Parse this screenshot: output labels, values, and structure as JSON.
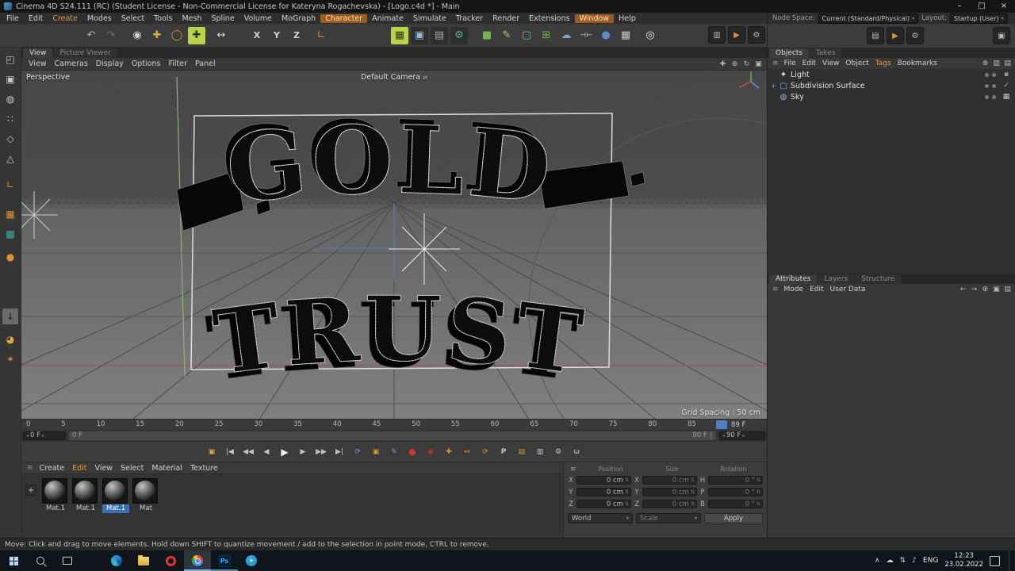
{
  "titlebar": {
    "title": "Cinema 4D S24.111 (RC) (Student License - Non-Commercial License for Kateryna Rogachevska) - [Logo.c4d *] - Main",
    "minimize": "–",
    "maximize": "□",
    "close": "×"
  },
  "menubar": {
    "items": [
      {
        "label": "File",
        "cls": "mb"
      },
      {
        "label": "Edit",
        "cls": "mb"
      },
      {
        "label": "Create",
        "cls": "mb accent-text"
      },
      {
        "label": "Modes",
        "cls": "mb"
      },
      {
        "label": "Select",
        "cls": "mb"
      },
      {
        "label": "Tools",
        "cls": "mb"
      },
      {
        "label": "Mesh",
        "cls": "mb"
      },
      {
        "label": "Spline",
        "cls": "mb"
      },
      {
        "label": "Volume",
        "cls": "mb"
      },
      {
        "label": "MoGraph",
        "cls": "mb"
      },
      {
        "label": "Character",
        "cls": "mb accent-bg"
      },
      {
        "label": "Animate",
        "cls": "mb"
      },
      {
        "label": "Simulate",
        "cls": "mb"
      },
      {
        "label": "Tracker",
        "cls": "mb"
      },
      {
        "label": "Render",
        "cls": "mb"
      },
      {
        "label": "Extensions",
        "cls": "mb"
      },
      {
        "label": "Window",
        "cls": "mb accent-bg"
      },
      {
        "label": "Help",
        "cls": "mb"
      }
    ]
  },
  "nodespace": {
    "label": "Node Space:",
    "value": "Current (Standard/Physical)",
    "layout_label": "Layout:",
    "layout_value": "Startup (User)",
    "arrow": "▾"
  },
  "toolbar": {
    "icons": [
      {
        "name": "undo-icon",
        "glyph": "↶",
        "style": "color:#b0b0b0"
      },
      {
        "name": "redo-icon",
        "glyph": "↷",
        "style": "color:#6e6e6e"
      },
      {
        "name": "live-selection-icon",
        "glyph": "◉",
        "style": "color:#cfcfcf"
      },
      {
        "name": "move-tool-icon",
        "glyph": "✚",
        "style": "color:#d9a648"
      },
      {
        "name": "rotate-tool-icon",
        "glyph": "◯",
        "style": "color:#e0912f"
      },
      {
        "name": "active-move-tool-icon",
        "glyph": "✚",
        "style": "background:#b8d24a;color:#2a3a10;border-radius:2px"
      },
      {
        "name": "scale-tool-icon",
        "glyph": "↔",
        "style": "color:#d8d8d8"
      },
      {
        "name": "axis-x-lock-button",
        "glyph": "X",
        "style": "color:#d0d0d0"
      },
      {
        "name": "axis-y-lock-button",
        "glyph": "Y",
        "style": "color:#d0d0d0"
      },
      {
        "name": "axis-z-lock-button",
        "glyph": "Z",
        "style": "color:#d0d0d0"
      },
      {
        "name": "coordinate-system-icon",
        "glyph": "∟",
        "style": "color:#e0912f"
      },
      {
        "name": "asset-browser-icon",
        "glyph": "▦",
        "style": "background:#b8d24a;color:#2a3a10;border-radius:2px"
      },
      {
        "name": "render-view-icon",
        "glyph": "▣",
        "style": "color:#8fb9d8;background:#2e2e2e;border-radius:2px"
      },
      {
        "name": "render-picture-viewer-icon",
        "glyph": "▤",
        "style": "color:#9aaab0;background:#2e2e2e;border-radius:2px"
      },
      {
        "name": "render-settings-icon",
        "glyph": "⚙",
        "style": "color:#49b3a2;background:#2e2e2e;border-radius:2px"
      },
      {
        "name": "add-cube-icon",
        "glyph": "■",
        "style": "color:#79b24a"
      },
      {
        "name": "pen-spline-icon",
        "glyph": "✎",
        "style": "color:#a8d06a"
      },
      {
        "name": "subdivision-surface-icon",
        "glyph": "▢",
        "style": "color:#6fc08a"
      },
      {
        "name": "cloner-icon",
        "glyph": "⊞",
        "style": "color:#6fb24a"
      },
      {
        "name": "volume-icon",
        "glyph": "☁",
        "style": "color:#7fa8c8"
      },
      {
        "name": "symmetry-icon",
        "glyph": "⊣⊢",
        "style": "color:#d8d8d8;font-size:9px"
      },
      {
        "name": "deformer-icon",
        "glyph": "●",
        "style": "color:#5b8fd0"
      },
      {
        "name": "array-icon",
        "glyph": "▦",
        "style": "color:#c8c8c8"
      },
      {
        "name": "light-object-icon",
        "glyph": "◎",
        "style": "color:#e8e8e8"
      }
    ],
    "right_icons": [
      {
        "name": "interactive-render-icon",
        "glyph": "▥",
        "style": ""
      },
      {
        "name": "render-queue-icon",
        "glyph": "▶",
        "style": "color:#e0912f"
      },
      {
        "name": "render-settings-gear-icon",
        "glyph": "⚙",
        "style": ""
      }
    ]
  },
  "left_toolbar": {
    "icons": [
      {
        "name": "make-editable-icon",
        "glyph": "◰",
        "style": "color:#c8c8c8"
      },
      {
        "name": "model-mode-icon",
        "glyph": "▣",
        "style": "color:#c8c8c8"
      },
      {
        "name": "texture-mode-icon",
        "glyph": "◍",
        "style": "color:#c8c8c8"
      },
      {
        "name": "point-mode-icon",
        "glyph": "∷",
        "style": "color:#c8c8c8"
      },
      {
        "name": "edge-mode-icon",
        "glyph": "◇",
        "style": "color:#c8c8c8"
      },
      {
        "name": "polygon-mode-icon",
        "glyph": "△",
        "style": "color:#c8c8c8"
      },
      {
        "name": "enable-axis-icon",
        "glyph": "∟",
        "style": "color:#e0912f"
      },
      {
        "name": "workplane-icon",
        "glyph": "▦",
        "style": "color:#e0912f"
      },
      {
        "name": "texture-axis-icon",
        "glyph": "▩",
        "style": "color:#3fae9f"
      },
      {
        "name": "paint-tool-icon",
        "glyph": "●",
        "style": "color:#e0912f"
      },
      {
        "name": "viewport-solo-icon",
        "glyph": "↓",
        "style": "background:#6a6a6a;color:#222;border-radius:2px"
      },
      {
        "name": "sculpt-icon",
        "glyph": "◕",
        "style": "color:#d9a648"
      },
      {
        "name": "snap-icon",
        "glyph": "✶",
        "style": "color:#e0912f"
      }
    ]
  },
  "viewport": {
    "tabs": [
      {
        "label": "View",
        "cls": "vtab active"
      },
      {
        "label": "Picture Viewer",
        "cls": "vtab"
      }
    ],
    "menu": [
      {
        "label": "View",
        "cls": "pm"
      },
      {
        "label": "Cameras",
        "cls": "pm"
      },
      {
        "label": "Display",
        "cls": "pm"
      },
      {
        "label": "Options",
        "cls": "pm"
      },
      {
        "label": "Filter",
        "cls": "pm"
      },
      {
        "label": "Panel",
        "cls": "pm"
      }
    ],
    "nav_icons": [
      {
        "name": "pan-view-icon",
        "glyph": "✚"
      },
      {
        "name": "zoom-view-icon",
        "glyph": "⊕"
      },
      {
        "name": "orbit-view-icon",
        "glyph": "↻"
      },
      {
        "name": "toggle-views-icon",
        "glyph": "▣"
      }
    ],
    "perspective_label": "Perspective",
    "camera_label": "Default Camera",
    "camera_switch_glyph": "⇄",
    "grid_spacing_label": "Grid Spacing : 50 cm",
    "text_top": "GOLD",
    "text_bottom": "TRUST"
  },
  "timeline": {
    "ticks": [
      "0",
      "5",
      "10",
      "15",
      "20",
      "25",
      "30",
      "35",
      "40",
      "45",
      "50",
      "55",
      "60",
      "65",
      "70",
      "75",
      "80",
      "85"
    ],
    "current_frame_label": "89 F",
    "range_start_value": "0 F",
    "range_bar_start": "0 F",
    "range_bar_end": "90 F",
    "range_grip": "∥",
    "range_end_value": "90 F",
    "spin_left": "◂",
    "spin_right": "▸"
  },
  "transport": {
    "icons": [
      {
        "name": "render-preview-icon",
        "glyph": "▣",
        "style": "color:#d9a648"
      },
      {
        "name": "go-to-start-icon",
        "glyph": "|◀",
        "style": ""
      },
      {
        "name": "previous-key-icon",
        "glyph": "◀◀",
        "style": ""
      },
      {
        "name": "previous-frame-icon",
        "glyph": "◀",
        "style": ""
      },
      {
        "name": "play-icon",
        "glyph": "▶",
        "style": ""
      },
      {
        "name": "next-frame-icon",
        "glyph": "▶",
        "style": ""
      },
      {
        "name": "next-key-icon",
        "glyph": "▶▶",
        "style": ""
      },
      {
        "name": "go-to-end-icon",
        "glyph": "▶|",
        "style": ""
      },
      {
        "name": "playback-loop-icon",
        "glyph": "⟳",
        "style": "color:#6f9fd8"
      },
      {
        "name": "keyframe-mode-icon",
        "glyph": "▣",
        "style": "color:#e0912f"
      },
      {
        "name": "animation-palette-icon",
        "glyph": "✎",
        "style": "color:#6f9fd8"
      },
      {
        "name": "record-keyframe-icon",
        "glyph": "●",
        "style": "color:#c0392b;font-size:11px"
      },
      {
        "name": "autokeying-icon",
        "glyph": "◉",
        "style": "color:#c0392b"
      },
      {
        "name": "record-position-icon",
        "glyph": "✚",
        "style": "color:#e0912f"
      },
      {
        "name": "record-scale-icon",
        "glyph": "↔",
        "style": "color:#e0912f"
      },
      {
        "name": "record-rotation-icon",
        "glyph": "⟳",
        "style": "color:#e0912f"
      },
      {
        "name": "record-parameter-icon",
        "glyph": "P",
        "style": "color:#c8c8c8;font-weight:bold"
      },
      {
        "name": "record-pla-icon",
        "glyph": "▤",
        "style": "color:#e0912f"
      },
      {
        "name": "keyframe-presets-icon",
        "glyph": "▥",
        "style": "color:#c8c8c8"
      },
      {
        "name": "project-settings-icon",
        "glyph": "⚙",
        "style": "color:#c8c8c8"
      },
      {
        "name": "character-solver-icon",
        "glyph": "ω",
        "style": "color:#c8c8c8"
      }
    ]
  },
  "materials": {
    "menu": [
      {
        "label": "Create",
        "cls": "pm"
      },
      {
        "label": "Edit",
        "cls": "pm accent"
      },
      {
        "label": "View",
        "cls": "pm"
      },
      {
        "label": "Select",
        "cls": "pm"
      },
      {
        "label": "Material",
        "cls": "pm"
      },
      {
        "label": "Texture",
        "cls": "pm"
      }
    ],
    "add_label": "+",
    "items": [
      {
        "label": "Mat.1",
        "cls": "mat-label"
      },
      {
        "label": "Mat.1",
        "cls": "mat-label"
      },
      {
        "label": "Mat.1",
        "cls": "mat-label selected"
      },
      {
        "label": "Mat",
        "cls": "mat-label"
      }
    ]
  },
  "coordinates": {
    "menu_glyph": "≡",
    "headers": [
      {
        "label": "Position"
      },
      {
        "label": "Size"
      },
      {
        "label": "Rotation"
      }
    ],
    "rows": [
      {
        "pl": "X",
        "pv": "0 cm",
        "sl": "X",
        "sv": "0 cm",
        "rl": "H",
        "rv": "0 °"
      },
      {
        "pl": "Y",
        "pv": "0 cm",
        "sl": "Y",
        "sv": "0 cm",
        "rl": "P",
        "rv": "0 °"
      },
      {
        "pl": "Z",
        "pv": "0 cm",
        "sl": "Z",
        "sv": "0 cm",
        "rl": "B",
        "rv": "0 °"
      }
    ],
    "world": "World",
    "scale": "Scale",
    "apply": "Apply",
    "dd_arrow": "▾",
    "spin": "⇅"
  },
  "panel_toolbar": {
    "icons": [
      {
        "name": "console-icon",
        "glyph": "▤",
        "style": ""
      },
      {
        "name": "play-icon",
        "glyph": "▶",
        "style": "color:#e0912f"
      },
      {
        "name": "gear-icon",
        "glyph": "⚙",
        "style": ""
      }
    ],
    "right_icon": {
      "name": "layout-icon",
      "glyph": "▣"
    }
  },
  "objects_panel": {
    "tabs": [
      {
        "label": "Objects",
        "cls": "vtab active"
      },
      {
        "label": "Takes",
        "cls": "vtab"
      }
    ],
    "menu": [
      {
        "label": "File",
        "cls": "pm"
      },
      {
        "label": "Edit",
        "cls": "pm"
      },
      {
        "label": "View",
        "cls": "pm"
      },
      {
        "label": "Object",
        "cls": "pm"
      },
      {
        "label": "Tags",
        "cls": "pm accent"
      },
      {
        "label": "Bookmarks",
        "cls": "pm"
      }
    ],
    "menu_icons": [
      {
        "name": "search-icon",
        "glyph": "⊕"
      },
      {
        "name": "filter-icon",
        "glyph": "▥"
      },
      {
        "name": "panel-menu-icon",
        "glyph": "▤"
      }
    ],
    "rows": [
      {
        "name": "Light",
        "expand": "",
        "icon_glyph": "✦",
        "icon_style": "color:#e8e8e8",
        "tag_glyph": "▪",
        "tag_style": "color:#999"
      },
      {
        "name": "Subdivision Surface",
        "expand": "+",
        "icon_glyph": "▢",
        "icon_style": "color:#6fb7e8",
        "tag_glyph": "✓",
        "tag_style": "color:#7ec97e"
      },
      {
        "name": "Sky",
        "expand": "",
        "icon_glyph": "◍",
        "icon_style": "color:#9ab8d0",
        "tag_glyph": "▦",
        "tag_style": "color:#c8c8c8"
      }
    ]
  },
  "attributes_panel": {
    "tabs": [
      {
        "label": "Attributes",
        "cls": "vtab active"
      },
      {
        "label": "Layers",
        "cls": "vtab"
      },
      {
        "label": "Structure",
        "cls": "vtab"
      }
    ],
    "menu": [
      {
        "label": "Mode",
        "cls": "pm"
      },
      {
        "label": "Edit",
        "cls": "pm"
      },
      {
        "label": "User Data",
        "cls": "pm"
      }
    ],
    "menu_icons": [
      {
        "name": "history-back-icon",
        "glyph": "←"
      },
      {
        "name": "history-forward-icon",
        "glyph": "→"
      },
      {
        "name": "find-icon",
        "glyph": "⊕"
      },
      {
        "name": "lock-icon",
        "glyph": "▣"
      },
      {
        "name": "panel-menu-icon",
        "glyph": "▤"
      }
    ]
  },
  "statusbar": {
    "text": "Move: Click and drag to move elements. Hold down SHIFT to quantize movement / add to the selection in point mode, CTRL to remove."
  },
  "taskbar": {
    "apps": [
      {
        "name": "microsoft-edge"
      },
      {
        "name": "file-explorer"
      },
      {
        "name": "opera-browser"
      },
      {
        "name": "google-chrome"
      },
      {
        "name": "photoshop",
        "glyph": "Ps"
      },
      {
        "name": "messenger",
        "glyph": "➤"
      }
    ],
    "tray": {
      "chevron": "∧",
      "icons": [
        {
          "name": "cloud-icon",
          "glyph": "☁"
        },
        {
          "name": "network-icon",
          "glyph": "⇅"
        },
        {
          "name": "volume-icon",
          "glyph": "♪"
        }
      ],
      "lang": "ENG",
      "time": "12:23",
      "date": "23.02.2022"
    }
  }
}
